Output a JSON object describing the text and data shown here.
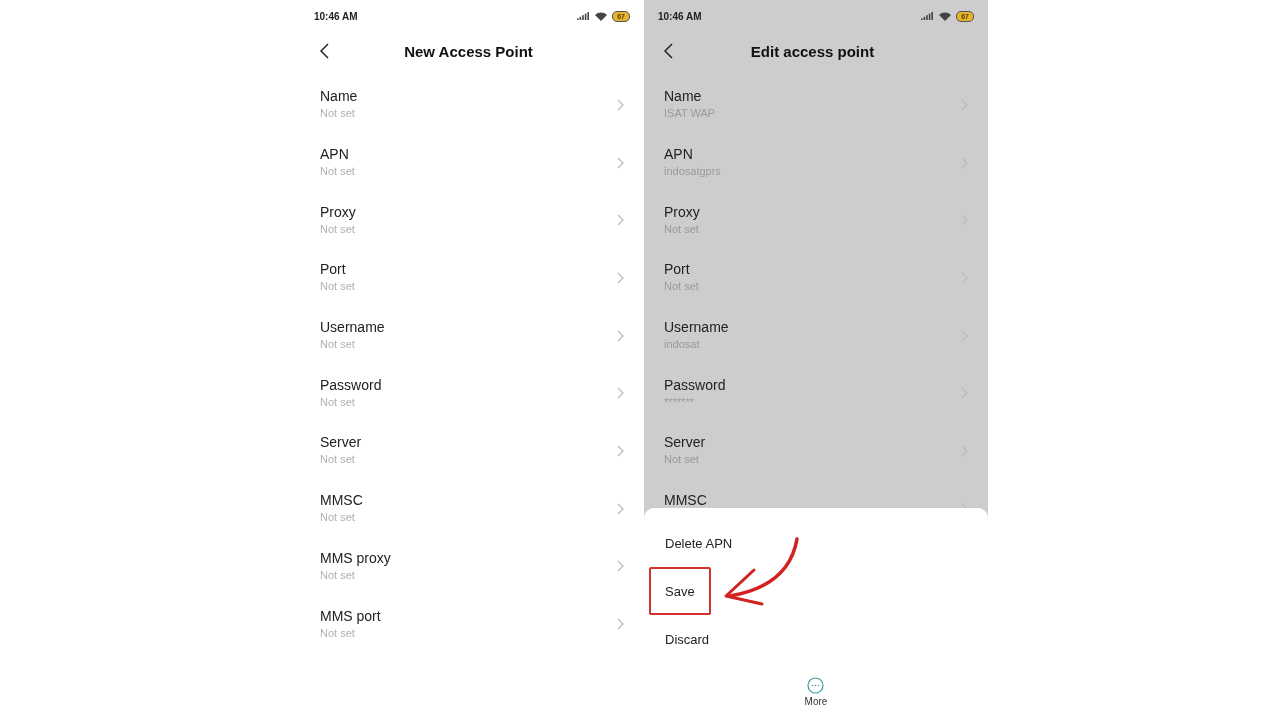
{
  "screens": [
    {
      "time": "10:46 AM",
      "battery": "67",
      "title": "New Access Point",
      "dimmed": false,
      "fields": [
        {
          "label": "Name",
          "value": "Not set"
        },
        {
          "label": "APN",
          "value": "Not set"
        },
        {
          "label": "Proxy",
          "value": "Not set"
        },
        {
          "label": "Port",
          "value": "Not set"
        },
        {
          "label": "Username",
          "value": "Not set"
        },
        {
          "label": "Password",
          "value": "Not set"
        },
        {
          "label": "Server",
          "value": "Not set"
        },
        {
          "label": "MMSC",
          "value": "Not set"
        },
        {
          "label": "MMS proxy",
          "value": "Not set"
        },
        {
          "label": "MMS port",
          "value": "Not set"
        }
      ]
    },
    {
      "time": "10:46 AM",
      "battery": "67",
      "title": "Edit access point",
      "dimmed": true,
      "fields": [
        {
          "label": "Name",
          "value": "ISAT WAP"
        },
        {
          "label": "APN",
          "value": "indosatgprs"
        },
        {
          "label": "Proxy",
          "value": "Not set"
        },
        {
          "label": "Port",
          "value": "Not set"
        },
        {
          "label": "Username",
          "value": "indosat"
        },
        {
          "label": "Password",
          "value": "*******"
        },
        {
          "label": "Server",
          "value": "Not set"
        },
        {
          "label": "MMSC"
        }
      ],
      "sheet": {
        "options": [
          {
            "label": "Delete APN",
            "highlighted": false
          },
          {
            "label": "Save",
            "highlighted": true
          },
          {
            "label": "Discard",
            "highlighted": false
          }
        ],
        "more": "More"
      }
    }
  ]
}
